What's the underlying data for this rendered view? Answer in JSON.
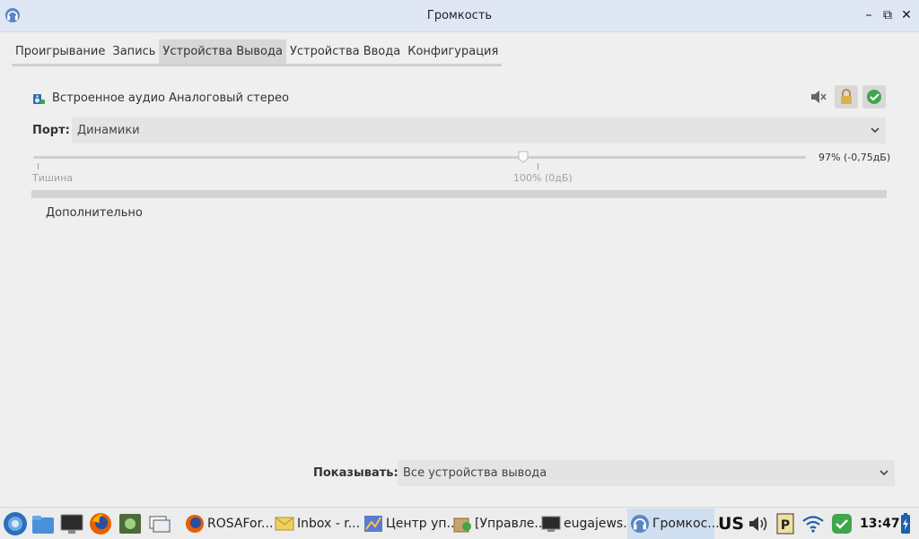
{
  "window": {
    "title": "Громкость",
    "controls": {
      "minimize": "–",
      "restore": "⧉",
      "close": "✕"
    }
  },
  "tabs": [
    {
      "label": "Проигрывание",
      "active": false
    },
    {
      "label": "Запись",
      "active": false
    },
    {
      "label": "Устройства Вывода",
      "active": true
    },
    {
      "label": "Устройства Ввода",
      "active": false
    },
    {
      "label": "Конфигурация",
      "active": false
    }
  ],
  "device": {
    "name": "Встроенное аудио Аналоговый стерео",
    "port_label": "Порт:",
    "port_value": "Динамики",
    "volume_percent": 97,
    "volume_text": "97% (-0,75дБ)",
    "tick_silence": "Тишина",
    "tick_100": "100% (0дБ)",
    "advanced_label": "Дополнительно",
    "locked": true,
    "default_device": true
  },
  "footer": {
    "show_label": "Показывать:",
    "show_value": "Все устройства вывода"
  },
  "taskbar": {
    "tasks": [
      {
        "label": "ROSAFor..."
      },
      {
        "label": "Inbox - r..."
      },
      {
        "label": "Центр уп..."
      },
      {
        "label": "[Управле..."
      },
      {
        "label": "eugajews..."
      },
      {
        "label": "Громкос..."
      }
    ],
    "keyboard_layout": "US",
    "clock": "13:47"
  },
  "colors": {
    "titlebar": "#dfe7f4",
    "window_bg": "#efefef",
    "tab_active": "#d7d7d7",
    "active_task": "#cfdff0",
    "accent_green": "#3fa64a"
  }
}
